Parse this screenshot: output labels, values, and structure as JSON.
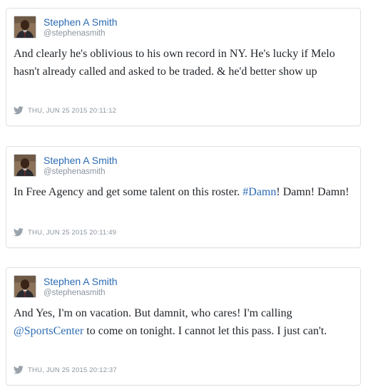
{
  "tweets": [
    {
      "author": "Stephen A Smith",
      "handle": "@stephenasmith",
      "text_parts": [
        "And clearly he's oblivious to his own record in NY. He's lucky if Melo hasn't already called and asked to be traded. & he'd better show up"
      ],
      "timestamp": "THU, JUN 25 2015 20:11:12"
    },
    {
      "author": "Stephen A Smith",
      "handle": "@stephenasmith",
      "text_parts": [
        "In Free Agency and get some talent on this roster. ",
        "#Damn",
        "! Damn! Damn!"
      ],
      "timestamp": "THU, JUN 25 2015 20:11:49"
    },
    {
      "author": "Stephen A Smith",
      "handle": "@stephenasmith",
      "text_parts": [
        "And Yes, I'm on vacation. But damnit, who cares! I'm calling ",
        "@SportsCenter",
        " to come on tonight. I cannot let this pass. I just can't."
      ],
      "timestamp": "THU, JUN 25 2015 20:12:37"
    }
  ],
  "colors": {
    "link": "#2b6bb2",
    "muted": "#8b949e",
    "border": "#dfe3e8"
  },
  "icons": {
    "avatar": "avatar",
    "twitter": "twitter-bird-icon"
  }
}
